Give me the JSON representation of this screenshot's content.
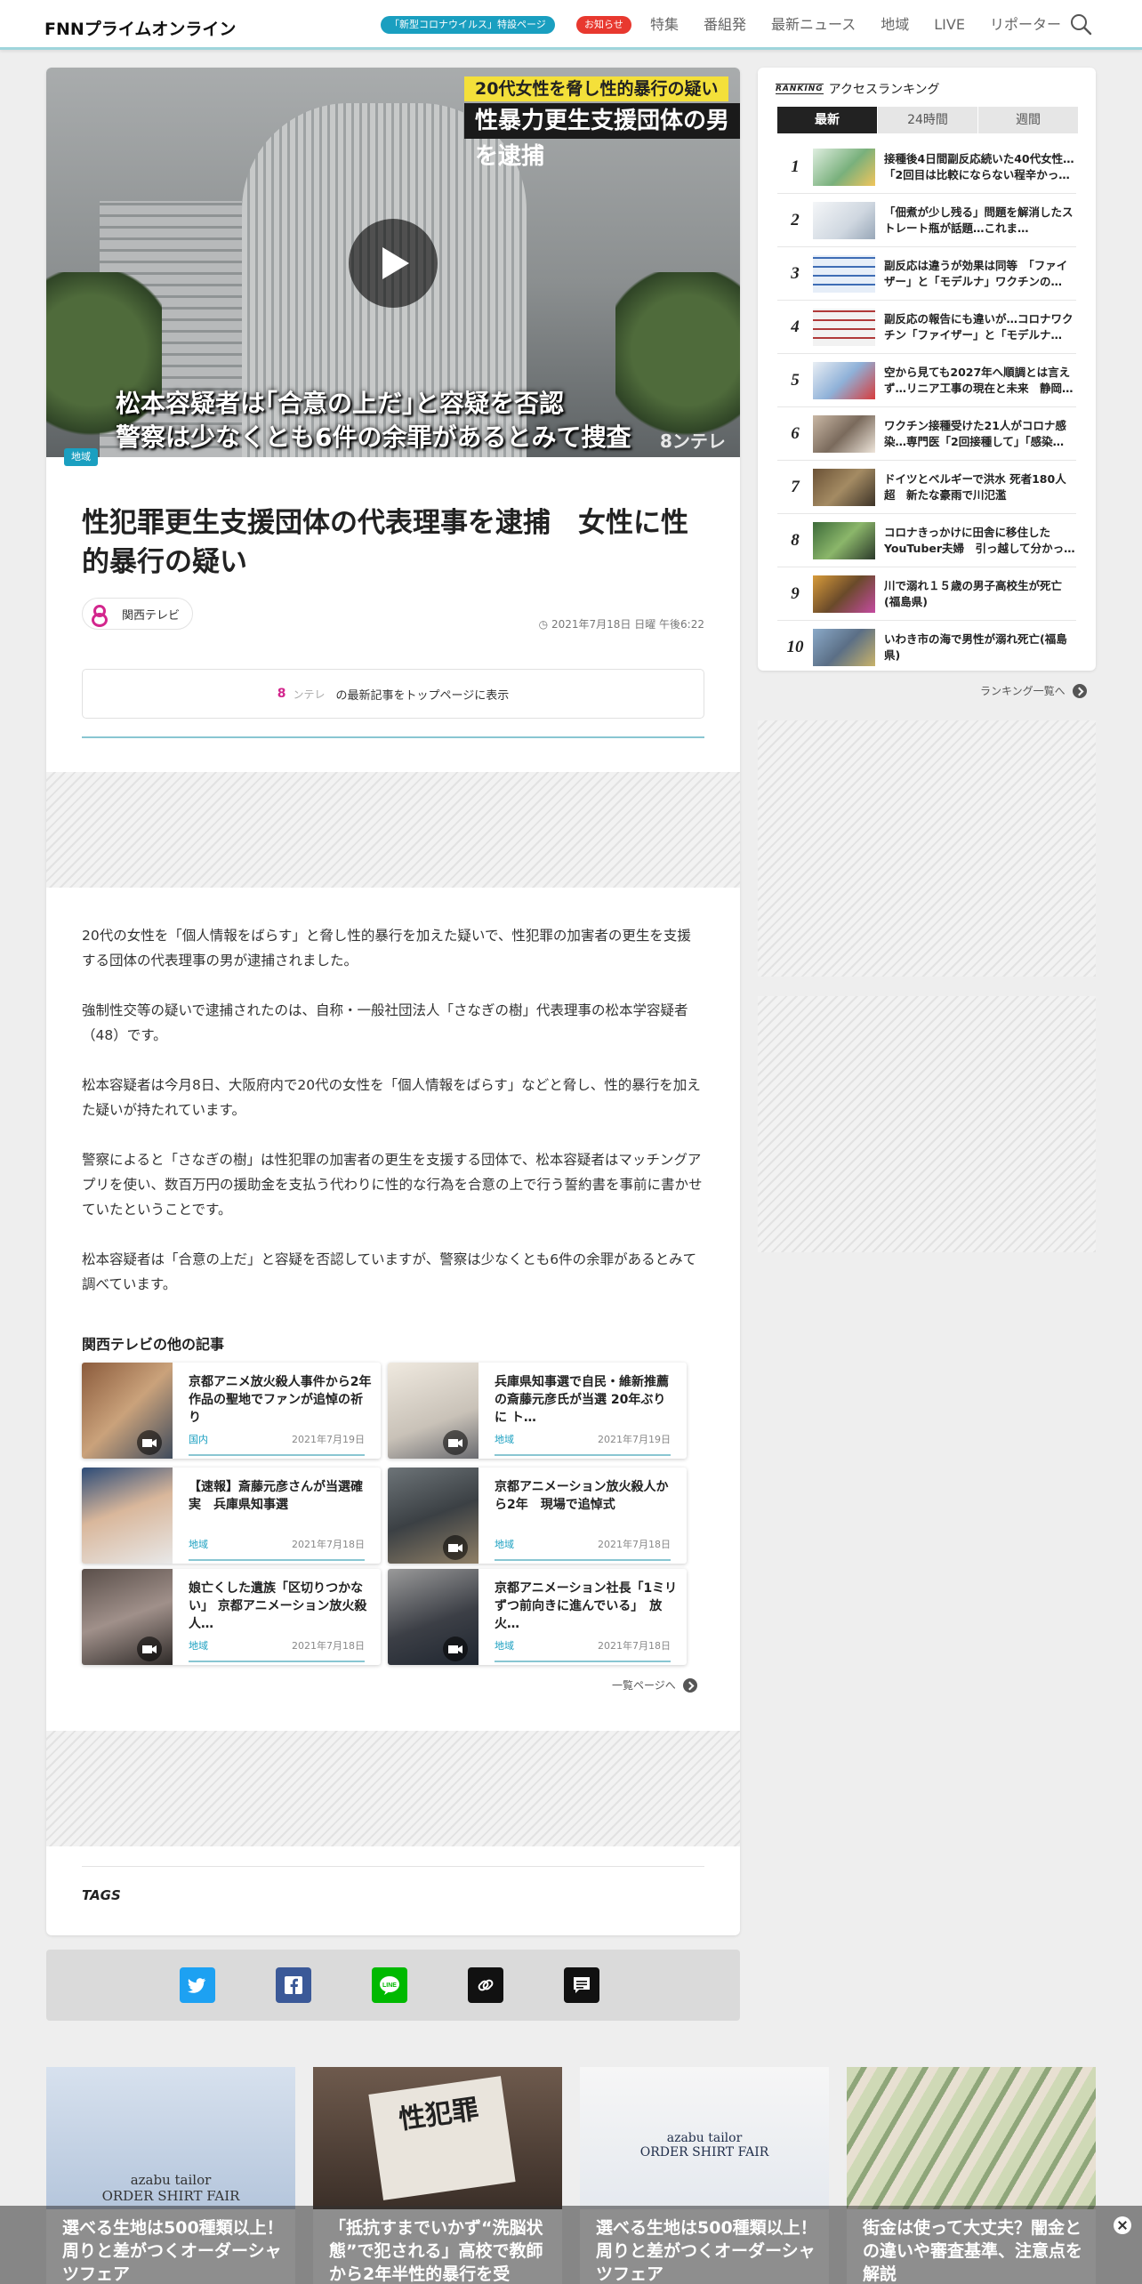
{
  "header": {
    "logo": "FNNプライムオンライン",
    "covid_pill": "「新型コロナウイルス」特設ページ",
    "notice_pill": "お知らせ",
    "nav": [
      "特集",
      "番組発",
      "最新ニュース",
      "地域",
      "LIVE",
      "リポーター"
    ]
  },
  "hero": {
    "tag_top": "20代女性を脅し性的暴行の疑い",
    "tag_main": "性暴力更生支援団体の男を逮捕",
    "caption_1": "松本容疑者は｢合意の上だ｣と容疑を否認",
    "caption_2": "警察は少なくとも6件の余罪があるとみて捜査",
    "watermark": "8ンテレ",
    "category": "地域"
  },
  "article": {
    "title": "性犯罪更生支援団体の代表理事を逮捕　女性に性的暴行の疑い",
    "source": "関西テレビ",
    "date": "2021年7月18日 日曜 午後6:22",
    "top_link_logo": "8",
    "top_link_brand": "ンテレ",
    "top_link_text": "の最新記事をトップページに表示",
    "paragraphs": [
      "20代の女性を「個人情報をばらす」と脅し性的暴行を加えた疑いで、性犯罪の加害者の更生を支援する団体の代表理事の男が逮捕されました。",
      "強制性交等の疑いで逮捕されたのは、自称・一般社団法人「さなぎの樹」代表理事の松本学容疑者（48）です。",
      "松本容疑者は今月8日、大阪府内で20代の女性を「個人情報をばらす」などと脅し、性的暴行を加えた疑いが持たれています。",
      "警察によると「さなぎの樹」は性犯罪の加害者の更生を支援する団体で、松本容疑者はマッチングアプリを使い、数百万円の援助金を支払う代わりに性的な行為を合意の上で行う誓約書を事前に書かせていたということです。",
      "松本容疑者は「合意の上だ」と容疑を否認していますが、警察は少なくとも6件の余罪があるとみて調べています。"
    ],
    "others_title": "関西テレビの他の記事",
    "others": [
      {
        "title": "京都アニメ放火殺人事件から2年 作品の聖地でファンが追悼の祈り",
        "category": "国内",
        "date": "2021年7月19日"
      },
      {
        "title": "兵庫県知事選で自民・維新推薦の斎藤元彦氏が当選 20年ぶりに ト…",
        "category": "地域",
        "date": "2021年7月19日"
      },
      {
        "title": "【速報】斎藤元彦さんが当選確実　兵庫県知事選",
        "category": "地域",
        "date": "2021年7月18日"
      },
      {
        "title": "京都アニメーション放火殺人から2年　現場で追悼式",
        "category": "地域",
        "date": "2021年7月18日"
      },
      {
        "title": "娘亡くした遺族「区切りつかない」 京都アニメーション放火殺人…",
        "category": "地域",
        "date": "2021年7月18日"
      },
      {
        "title": "京都アニメーション社長「1ミリずつ前向きに進んでいる」　放火…",
        "category": "地域",
        "date": "2021年7月18日"
      }
    ],
    "more_link": "一覧ページへ",
    "tags_label": "TAGS"
  },
  "ranking": {
    "label_small": "RANKING",
    "title": "アクセスランキング",
    "tabs": [
      "最新",
      "24時間",
      "週間"
    ],
    "items": [
      {
        "num": "1",
        "text": "接種後4日間副反応続いた40代女性…「2回目は比較にならない程辛かっ…"
      },
      {
        "num": "2",
        "text": "「佃煮が少し残る」問題を解消したストレート瓶が話題…これま…"
      },
      {
        "num": "3",
        "text": "副反応は違うが効果は同等　「ファイザー」と「モデルナ」ワクチンの…"
      },
      {
        "num": "4",
        "text": "副反応の報告にも違いが…コロナワクチン「ファイザー」と「モデルナ…"
      },
      {
        "num": "5",
        "text": "空から見ても2027年へ順調とは言えず…リニア工事の現在と未来　静岡…"
      },
      {
        "num": "6",
        "text": "ワクチン接種受けた21人がコロナ感染…専門医「2回接種して」「感染…"
      },
      {
        "num": "7",
        "text": "ドイツとベルギーで洪水 死者180人超　新たな豪雨で川氾濫"
      },
      {
        "num": "8",
        "text": "コロナきっかけに田舎に移住したYouTuber夫婦　引っ越して分かっ…"
      },
      {
        "num": "9",
        "text": "川で溺れ１５歳の男子高校生が死亡(福島県)"
      },
      {
        "num": "10",
        "text": "いわき市の海で男性が溺れ死亡(福島県)"
      }
    ],
    "more_link": "ランキング一覧へ"
  },
  "recommendations": [
    {
      "title": "選べる生地は500種類以上！周りと差がつくオーダーシャツフェア",
      "img_text": "azabu tailor\nORDER SHIRT FAIR"
    },
    {
      "title": "「抵抗すまでいかず“洗脳状態”で犯される」高校で教師から2年半性的暴行を受",
      "img_text": "性犯罪"
    },
    {
      "title": "選べる生地は500種類以上！周りと差がつくオーダーシャツフェア",
      "img_text": "azabu tailor\nORDER SHIRT FAIR"
    },
    {
      "title": "街金は使って大丈夫？闇金との違いや審査基準、注意点を解説",
      "img_text": ""
    }
  ],
  "colors": {
    "accent": "#1a9fc0",
    "notice": "#e8382f",
    "brand_kt": "#d3268d"
  }
}
